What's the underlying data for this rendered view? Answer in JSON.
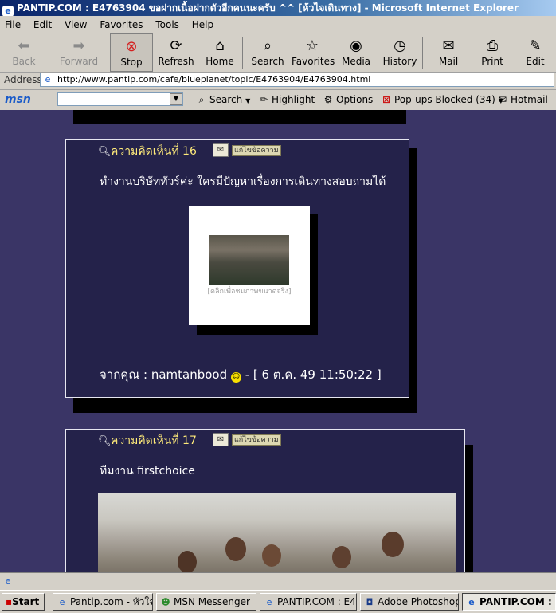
{
  "window": {
    "title": "PANTIP.COM : E4763904 ขอฝากเนื้อฝากตัวอีกคนนะครับ ^^ [ห้วไจเดินทาง] - Microsoft Internet Explorer"
  },
  "menu": [
    "File",
    "Edit",
    "View",
    "Favorites",
    "Tools",
    "Help"
  ],
  "toolbar": {
    "back": "Back",
    "forward": "Forward",
    "stop": "Stop",
    "refresh": "Refresh",
    "home": "Home",
    "search": "Search",
    "favorites": "Favorites",
    "media": "Media",
    "history": "History",
    "mail": "Mail",
    "print": "Print",
    "edit": "Edit"
  },
  "address": {
    "label": "Address",
    "url": "http://www.pantip.com/cafe/blueplanet/topic/E4763904/E4763904.html"
  },
  "msnbar": {
    "logo": "msn",
    "search_value": "",
    "search": "Search",
    "highlight": "Highlight",
    "options": "Options",
    "popups": "Pop-ups Blocked (34)",
    "hotmail": "Hotmail"
  },
  "comments": [
    {
      "heading": "ความคิดเห็นที่ 16",
      "edit_label": "แก้ไขข้อความ",
      "text": "ทำงานบริษัททัวร์ค่ะ ใครมีปัญหาเรื่องการเดินทางสอบถามได้",
      "photo_caption": "[คลิกเพื่อชมภาพขนาดจริง]",
      "footer": "จากคุณ : namtanbood",
      "footer_time": "- [ 6 ต.ค. 49 11:50:22 ]"
    },
    {
      "heading": "ความคิดเห็นที่ 17",
      "edit_label": "แก้ไขข้อความ",
      "text": "ทีมงาน firstchoice"
    }
  ],
  "taskbar": {
    "start": "Start",
    "tasks": [
      "Pantip.com - หัวใจเ...",
      "MSN Messenger",
      "PANTIP.COM : E4...",
      "Adobe Photoshop",
      "PANTIP.COM : ..."
    ]
  },
  "colors": {
    "page_bg": "#3a3566",
    "card_bg": "#24224a",
    "heading": "#ffeb7a"
  }
}
